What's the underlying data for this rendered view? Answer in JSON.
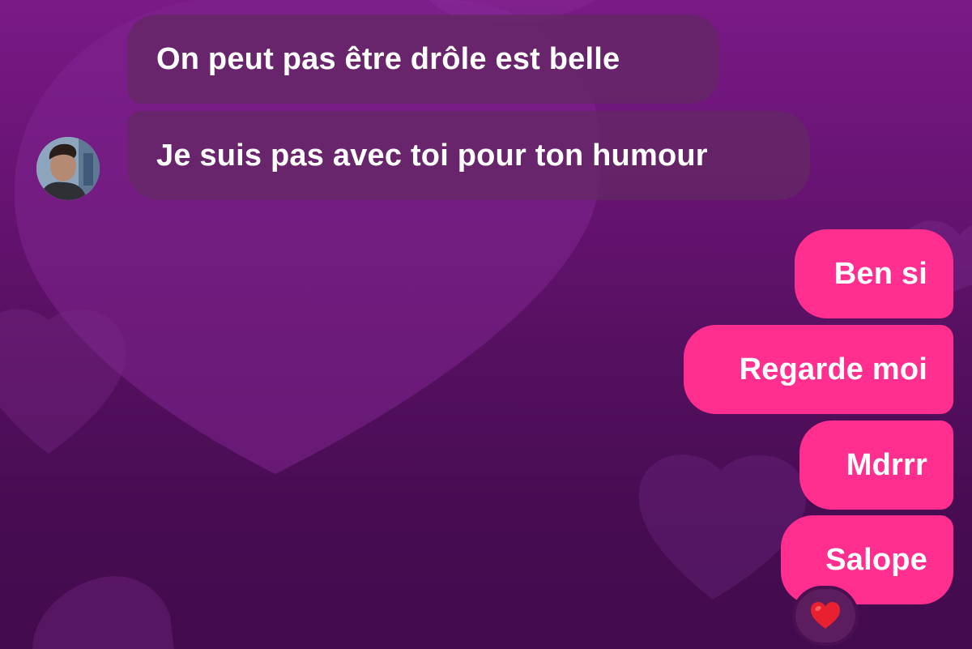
{
  "conversation": {
    "incoming_messages": [
      {
        "text": "On peut pas être drôle est belle"
      },
      {
        "text": "Je suis pas avec toi pour ton humour"
      }
    ],
    "outgoing_messages": [
      {
        "text": "Ben si"
      },
      {
        "text": "Regarde moi"
      },
      {
        "text": "Mdrrr"
      },
      {
        "text": "Salope"
      }
    ],
    "reaction": {
      "icon": "heart-icon",
      "color": "#e8202f"
    },
    "sender_avatar": {
      "icon": "avatar"
    }
  },
  "theme": {
    "background": "#55105f",
    "incoming_bubble": "#642864",
    "outgoing_bubble": "#ff2e8f",
    "text_color": "#ffffff"
  }
}
